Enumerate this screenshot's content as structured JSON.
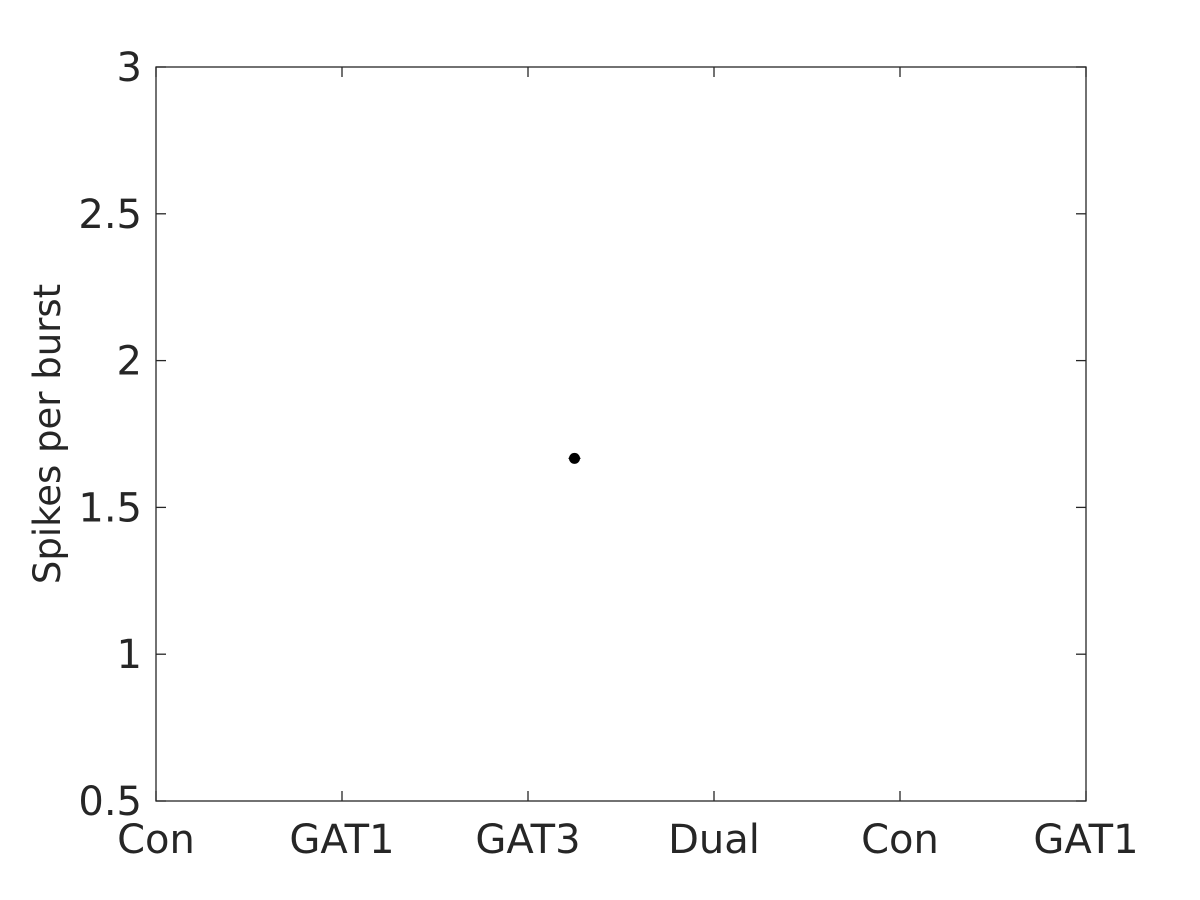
{
  "chart_data": {
    "type": "scatter",
    "title": "",
    "xlabel": "",
    "ylabel": "Spikes per burst",
    "categories": [
      "Con",
      "GAT1",
      "GAT3",
      "Dual",
      "Con",
      "GAT1"
    ],
    "xlim": [
      1,
      6
    ],
    "ylim": [
      0.5,
      3
    ],
    "yticks": [
      0.5,
      1,
      1.5,
      2,
      2.5,
      3
    ],
    "ytick_labels": [
      "0.5",
      "1",
      "1.5",
      "2",
      "2.5",
      "3"
    ],
    "grid": false,
    "series": [
      {
        "name": "data",
        "color": "#000000",
        "points": [
          {
            "x": 3.25,
            "y": 1.667
          }
        ]
      }
    ]
  }
}
